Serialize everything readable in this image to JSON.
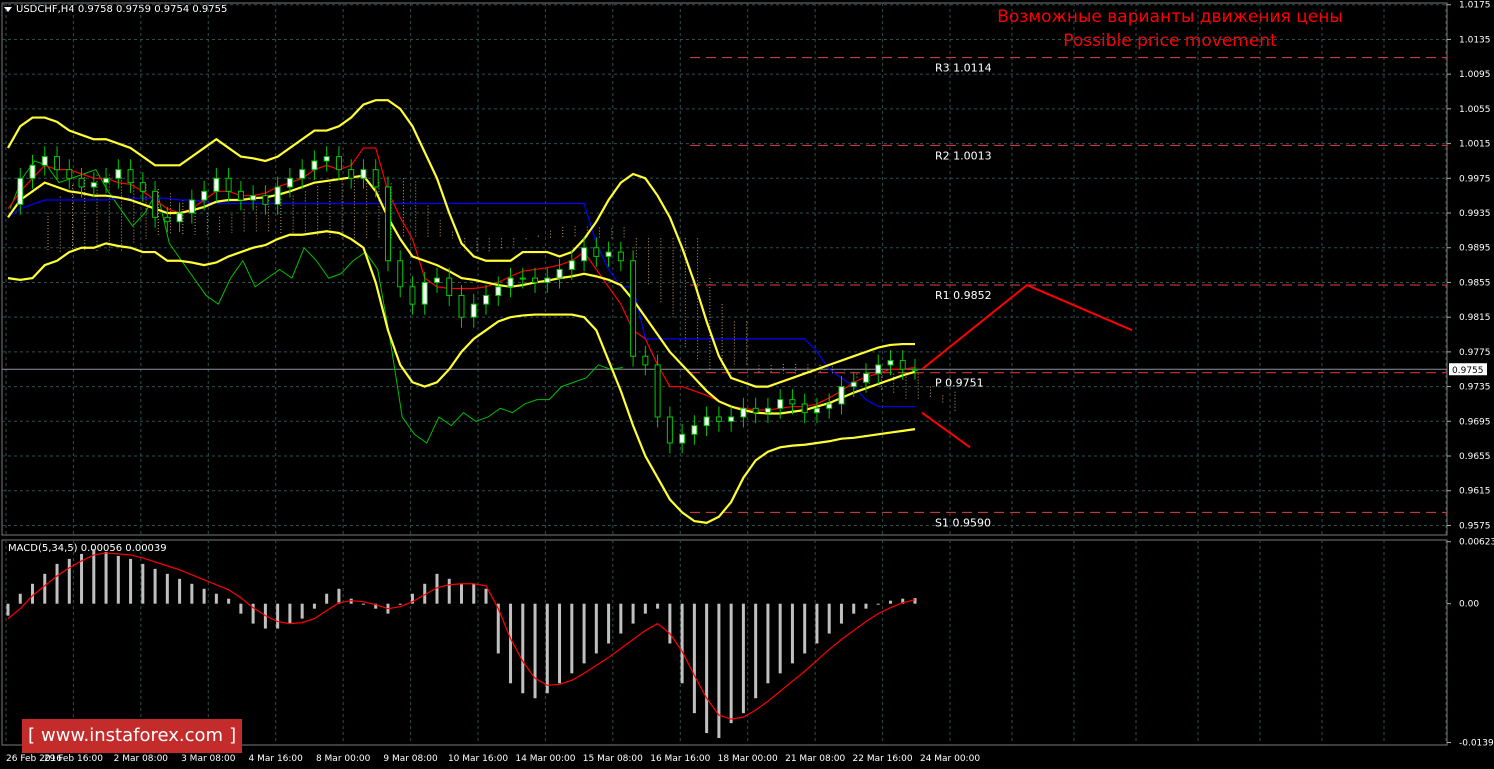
{
  "symbol_header": "USDCHF,H4  0.9758 0.9759 0.9754 0.9755",
  "macd_header": "MACD(5,34,5) 0.00056 0.00039",
  "forecast": {
    "title_ru": "Возможные варианты движения цены",
    "title_en": "Possible price movement",
    "color": "#ff0000"
  },
  "watermark": {
    "text": "www.instaforex.com",
    "bg_color": "#c42b2b"
  },
  "colors": {
    "background": "#000000",
    "grid": "#2f4f4f",
    "bollinger": "#ffff33",
    "candle_bull": "#ffffff",
    "candle_wick": "#00c800",
    "kijun": "#0000ff",
    "tenkan": "#ff0000",
    "chikou": "#00c000",
    "pivot_lines": "#e04040",
    "macd_hist": "#c0c0c0",
    "macd_signal": "#ff0000"
  },
  "chart_data": [
    {
      "type": "line",
      "title": "USDCHF,H4",
      "subtitle": "Возможные варианты движения цены / Possible price movement",
      "grid": true,
      "y_ticks": [
        "1.0175",
        "1.0135",
        "1.0095",
        "1.0055",
        "1.0015",
        "0.9975",
        "0.9935",
        "0.9895",
        "0.9855",
        "0.9815",
        "0.9775",
        "0.9735",
        "0.9695",
        "0.9655",
        "0.9615",
        "0.9575"
      ],
      "ylim": [
        0.9564,
        1.0177
      ],
      "x_tick_labels": [
        "26 Feb 2016",
        "29 Feb 16:00",
        "2 Mar 08:00",
        "3 Mar 08:00",
        "4 Mar 16:00",
        "8 Mar 00:00",
        "9 Mar 08:00",
        "10 Mar 16:00",
        "14 Mar 00:00",
        "15 Mar 08:00",
        "16 Mar 16:00",
        "18 Mar 00:00",
        "21 Mar 08:00",
        "22 Mar 16:00",
        "24 Mar 00:00"
      ],
      "current_price": "0.9755",
      "pivot_levels": [
        {
          "name": "R3",
          "value": 1.0114,
          "label": "R3  1.0114"
        },
        {
          "name": "R2",
          "value": 1.0013,
          "label": "R2  1.0013"
        },
        {
          "name": "R1",
          "value": 0.9852,
          "label": "R1  0.9852"
        },
        {
          "name": "P",
          "value": 0.9751,
          "label": "P  0.9751"
        },
        {
          "name": "S1",
          "value": 0.959,
          "label": "S1  0.9590"
        }
      ],
      "forecast_paths": [
        {
          "name": "up",
          "points": [
            [
              0,
              0.9755
            ],
            [
              1,
              0.9852
            ],
            [
              2,
              0.98
            ]
          ]
        },
        {
          "name": "down",
          "points": [
            [
              0,
              0.9705
            ],
            [
              1,
              0.9665
            ]
          ]
        }
      ],
      "series": [
        {
          "key": "close",
          "values": [
            0.9945,
            0.9975,
            0.999,
            1.0,
            0.9985,
            0.9975,
            0.9965,
            0.997,
            0.9975,
            0.9985,
            0.997,
            0.996,
            0.993,
            0.9925,
            0.9935,
            0.995,
            0.996,
            0.9975,
            0.996,
            0.995,
            0.9955,
            0.9945,
            0.9965,
            0.9975,
            0.9985,
            0.9995,
            1.0,
            0.9985,
            0.9975,
            0.9985,
            0.9965,
            0.988,
            0.985,
            0.983,
            0.9855,
            0.986,
            0.984,
            0.9815,
            0.983,
            0.984,
            0.985,
            0.986,
            0.986,
            0.9855,
            0.986,
            0.987,
            0.988,
            0.9895,
            0.9885,
            0.989,
            0.988,
            0.977,
            0.976,
            0.97,
            0.967,
            0.968,
            0.969,
            0.97,
            0.9695,
            0.97,
            0.971,
            0.9705,
            0.971,
            0.972,
            0.9715,
            0.9705,
            0.971,
            0.9715,
            0.9735,
            0.974,
            0.975,
            0.976,
            0.9765,
            0.9755,
            0.9755
          ]
        },
        {
          "key": "bb_upper",
          "values": [
            1.001,
            1.0035,
            1.0045,
            1.0045,
            1.004,
            1.003,
            1.0025,
            1.002,
            1.002,
            1.0015,
            1.001,
            1.0,
            0.999,
            0.999,
            0.999,
            1.0,
            1.001,
            1.002,
            1.001,
            1.0,
            0.9998,
            0.9995,
            1.0,
            1.001,
            1.002,
            1.003,
            1.003,
            1.0035,
            1.0045,
            1.006,
            1.0065,
            1.0065,
            1.0055,
            1.0035,
            1.0005,
            0.9975,
            0.9935,
            0.99,
            0.9885,
            0.988,
            0.988,
            0.988,
            0.989,
            0.989,
            0.989,
            0.9885,
            0.989,
            0.9905,
            0.9925,
            0.995,
            0.997,
            0.998,
            0.9975,
            0.9955,
            0.993,
            0.9895,
            0.9855,
            0.981,
            0.977,
            0.9745,
            0.974,
            0.9735,
            0.9735,
            0.974,
            0.9745,
            0.975,
            0.9755,
            0.976,
            0.9765,
            0.977,
            0.9775,
            0.978,
            0.9783,
            0.9784,
            0.9784
          ]
        },
        {
          "key": "bb_mid",
          "values": [
            0.993,
            0.995,
            0.996,
            0.997,
            0.9965,
            0.996,
            0.9958,
            0.9955,
            0.9955,
            0.9953,
            0.995,
            0.9945,
            0.994,
            0.9935,
            0.9935,
            0.9938,
            0.9942,
            0.9948,
            0.995,
            0.995,
            0.9952,
            0.9953,
            0.9956,
            0.996,
            0.9965,
            0.997,
            0.9972,
            0.9974,
            0.9976,
            0.9978,
            0.996,
            0.993,
            0.9905,
            0.9885,
            0.988,
            0.9875,
            0.9868,
            0.986,
            0.9858,
            0.9855,
            0.9852,
            0.985,
            0.9852,
            0.9855,
            0.9857,
            0.986,
            0.9862,
            0.9865,
            0.9862,
            0.9858,
            0.9852,
            0.9835,
            0.9815,
            0.9795,
            0.9775,
            0.976,
            0.9745,
            0.973,
            0.9718,
            0.9712,
            0.9708,
            0.9705,
            0.9704,
            0.9704,
            0.9706,
            0.9708,
            0.9712,
            0.9716,
            0.9722,
            0.9728,
            0.9733,
            0.9738,
            0.9743,
            0.9748,
            0.9752
          ]
        },
        {
          "key": "bb_lower",
          "values": [
            0.986,
            0.9858,
            0.986,
            0.9875,
            0.988,
            0.989,
            0.9895,
            0.9895,
            0.99,
            0.9897,
            0.9895,
            0.989,
            0.989,
            0.988,
            0.988,
            0.9878,
            0.9875,
            0.9878,
            0.9885,
            0.989,
            0.9895,
            0.9898,
            0.9905,
            0.991,
            0.991,
            0.9912,
            0.9914,
            0.9912,
            0.9905,
            0.9895,
            0.9855,
            0.98,
            0.976,
            0.974,
            0.9735,
            0.974,
            0.9755,
            0.9775,
            0.979,
            0.98,
            0.981,
            0.9815,
            0.9817,
            0.9818,
            0.9818,
            0.9818,
            0.9818,
            0.9815,
            0.98,
            0.9765,
            0.973,
            0.969,
            0.9655,
            0.963,
            0.9605,
            0.959,
            0.958,
            0.9578,
            0.9585,
            0.9602,
            0.963,
            0.965,
            0.966,
            0.9665,
            0.9667,
            0.9668,
            0.967,
            0.9672,
            0.9675,
            0.9676,
            0.9678,
            0.968,
            0.9682,
            0.9684,
            0.9686
          ]
        },
        {
          "key": "kijun",
          "values": [
            0.993,
            0.994,
            0.9945,
            0.995,
            0.995,
            0.995,
            0.995,
            0.995,
            0.995,
            0.9952,
            0.9952,
            0.9952,
            0.9952,
            0.9952,
            0.995,
            0.995,
            0.9948,
            0.9946,
            0.9946,
            0.9946,
            0.9946,
            0.9946,
            0.9946,
            0.9946,
            0.9946,
            0.9946,
            0.9946,
            0.9946,
            0.9946,
            0.9946,
            0.9946,
            0.9946,
            0.9946,
            0.9946,
            0.9946,
            0.9946,
            0.9946,
            0.9946,
            0.9946,
            0.9946,
            0.9946,
            0.9946,
            0.9946,
            0.9946,
            0.9946,
            0.9946,
            0.9946,
            0.9946,
            0.99,
            0.987,
            0.985,
            0.985,
            0.979,
            0.979,
            0.979,
            0.979,
            0.979,
            0.979,
            0.979,
            0.979,
            0.979,
            0.979,
            0.979,
            0.979,
            0.979,
            0.979,
            0.9775,
            0.9755,
            0.9745,
            0.9735,
            0.972,
            0.9712,
            0.9712,
            0.9712,
            0.9712
          ]
        },
        {
          "key": "tenkan",
          "values": [
            0.994,
            0.996,
            0.9975,
            0.999,
            0.9985,
            0.9985,
            0.998,
            0.9975,
            0.9975,
            0.997,
            0.9968,
            0.996,
            0.995,
            0.994,
            0.9935,
            0.994,
            0.995,
            0.996,
            0.996,
            0.9955,
            0.9955,
            0.9958,
            0.9965,
            0.997,
            0.9975,
            0.9985,
            0.999,
            0.9985,
            0.999,
            1.001,
            1.001,
            0.996,
            0.993,
            0.9905,
            0.986,
            0.985,
            0.9848,
            0.9848,
            0.9848,
            0.985,
            0.9855,
            0.9862,
            0.9868,
            0.987,
            0.9872,
            0.9875,
            0.988,
            0.989,
            0.987,
            0.985,
            0.983,
            0.98,
            0.979,
            0.976,
            0.9735,
            0.9735,
            0.973,
            0.9725,
            0.9718,
            0.9712,
            0.971,
            0.9708,
            0.9708,
            0.971,
            0.9712,
            0.9712,
            0.9715,
            0.9722,
            0.973,
            0.974,
            0.9746,
            0.975,
            0.9755,
            0.9755,
            0.9757
          ]
        },
        {
          "key": "chikou",
          "values": [
            0.994,
            0.9975,
            0.9995,
            0.999,
            0.997,
            0.9975,
            0.998,
            0.9985,
            0.996,
            0.994,
            0.992,
            0.9935,
            0.996,
            0.99,
            0.988,
            0.986,
            0.984,
            0.983,
            0.986,
            0.988,
            0.985,
            0.986,
            0.987,
            0.986,
            0.9895,
            0.988,
            0.986,
            0.9865,
            0.988,
            0.989,
            0.987,
            0.979,
            0.97,
            0.968,
            0.967,
            0.97,
            0.969,
            0.9705,
            0.9695,
            0.97,
            0.971,
            0.9705,
            0.9715,
            0.972,
            0.972,
            0.9735,
            0.974,
            0.9745,
            0.976,
            0.9755,
            0.9757
          ]
        }
      ]
    },
    {
      "type": "bar",
      "title": "MACD(5,34,5)",
      "y_ticks": [
        "0.00623",
        "0.00",
        "-0.01395"
      ],
      "ylim": [
        -0.0142,
        0.0064
      ],
      "series": [
        {
          "name": "MACD",
          "values": [
            -0.0012,
            0.001,
            0.002,
            0.003,
            0.004,
            0.0045,
            0.005,
            0.0055,
            0.0052,
            0.0048,
            0.0045,
            0.004,
            0.0035,
            0.003,
            0.0025,
            0.002,
            0.0015,
            0.001,
            0.0005,
            -0.001,
            -0.002,
            -0.0025,
            -0.0025,
            -0.002,
            -0.0015,
            -0.0005,
            0.001,
            0.0015,
            0.0005,
            0.0,
            -0.0005,
            -0.001,
            0.0,
            0.001,
            0.002,
            0.003,
            0.0025,
            0.002,
            0.002,
            0.0015,
            -0.005,
            -0.008,
            -0.009,
            -0.0095,
            -0.009,
            -0.008,
            -0.007,
            -0.006,
            -0.005,
            -0.004,
            -0.003,
            -0.002,
            -0.001,
            -0.0005,
            -0.004,
            -0.008,
            -0.011,
            -0.013,
            -0.0135,
            -0.012,
            -0.011,
            -0.0095,
            -0.008,
            -0.007,
            -0.006,
            -0.005,
            -0.004,
            -0.003,
            -0.002,
            -0.001,
            -0.0005,
            0.0,
            0.0003,
            0.0005,
            0.00056
          ]
        },
        {
          "name": "Signal",
          "values": [
            -0.0015,
            -0.0005,
            0.0008,
            0.0018,
            0.0028,
            0.0036,
            0.0043,
            0.0049,
            0.0051,
            0.005,
            0.0049,
            0.0046,
            0.0042,
            0.0038,
            0.0034,
            0.0029,
            0.0024,
            0.0019,
            0.0014,
            0.0006,
            -0.0004,
            -0.0012,
            -0.0018,
            -0.002,
            -0.0019,
            -0.0015,
            -0.0007,
            0.0001,
            0.0003,
            0.0002,
            -0.0001,
            -0.0005,
            -0.0003,
            0.0002,
            0.0009,
            0.0016,
            0.0019,
            0.002,
            0.002,
            0.0018,
            -0.0005,
            -0.0035,
            -0.0058,
            -0.0075,
            -0.0082,
            -0.0081,
            -0.0077,
            -0.007,
            -0.0062,
            -0.0054,
            -0.0045,
            -0.0036,
            -0.0027,
            -0.002,
            -0.003,
            -0.0048,
            -0.0072,
            -0.0095,
            -0.0112,
            -0.0116,
            -0.0114,
            -0.0107,
            -0.0098,
            -0.0088,
            -0.0078,
            -0.0068,
            -0.0057,
            -0.0046,
            -0.0036,
            -0.0027,
            -0.0018,
            -0.001,
            -0.0004,
            0.0001,
            0.00039
          ]
        }
      ]
    }
  ]
}
